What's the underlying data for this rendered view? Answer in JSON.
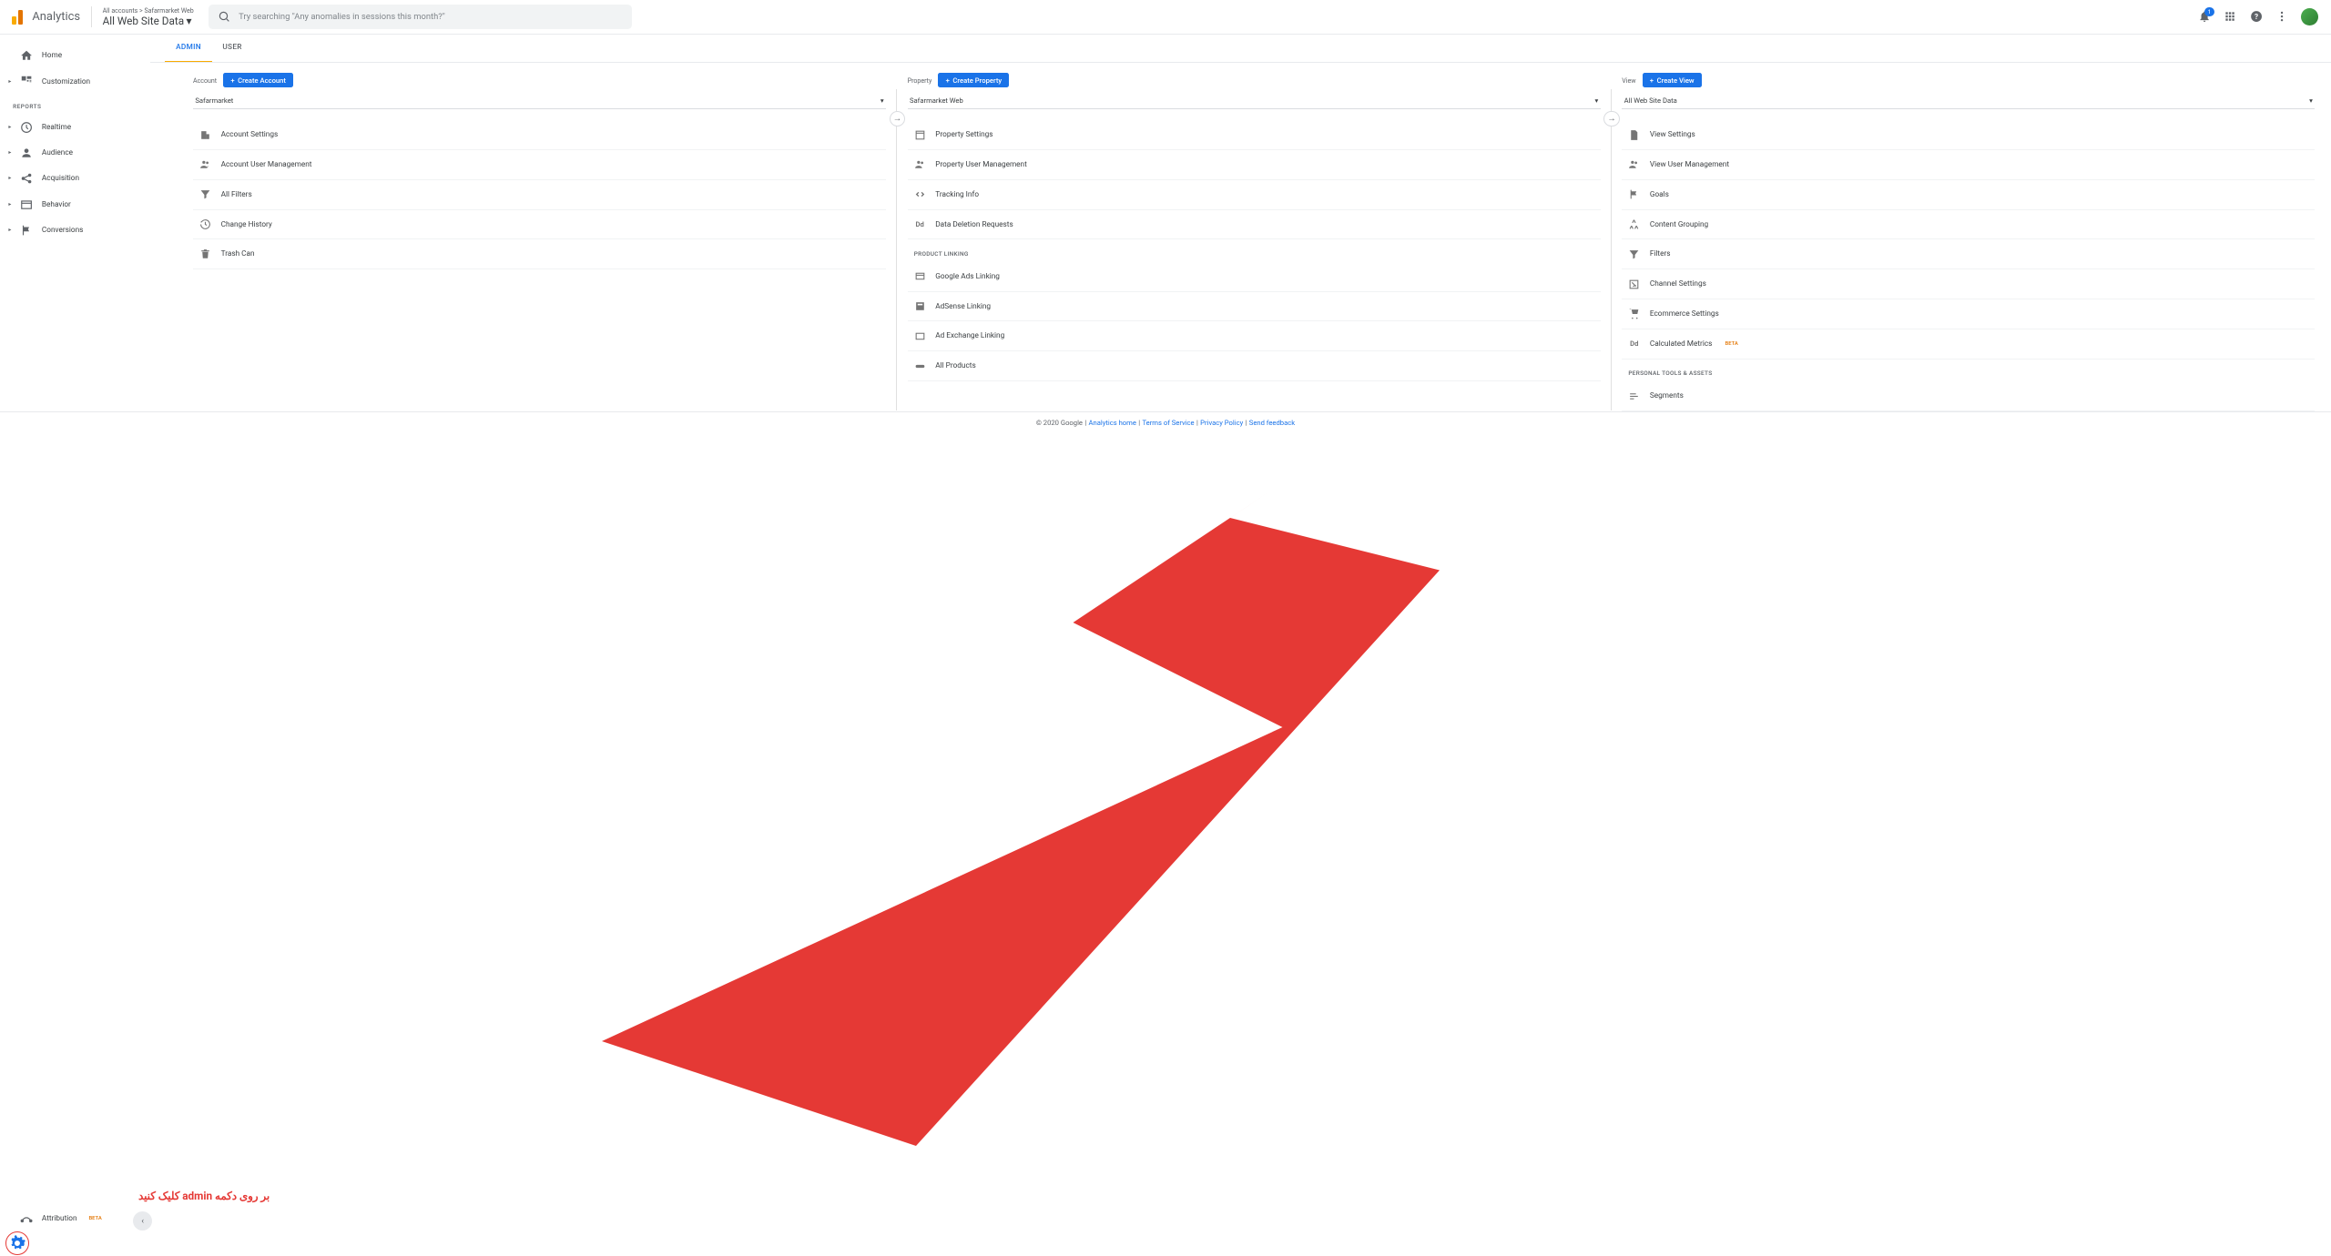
{
  "header": {
    "logo_text": "Analytics",
    "breadcrumb": "All accounts > Safarmarket Web",
    "property_name": "All Web Site Data",
    "search_placeholder": "Try searching \"Any anomalies in sessions this month?\"",
    "notif_count": "1"
  },
  "sidebar": {
    "home": "Home",
    "customization": "Customization",
    "reports_label": "REPORTS",
    "realtime": "Realtime",
    "audience": "Audience",
    "acquisition": "Acquisition",
    "behavior": "Behavior",
    "conversions": "Conversions",
    "attribution": "Attribution",
    "attribution_badge": "BETA"
  },
  "tabs": {
    "admin": "ADMIN",
    "user": "USER"
  },
  "account": {
    "label": "Account",
    "create": "Create Account",
    "selected": "Safarmarket",
    "items": [
      "Account Settings",
      "Account User Management",
      "All Filters",
      "Change History",
      "Trash Can"
    ]
  },
  "property": {
    "label": "Property",
    "create": "Create Property",
    "selected": "Safarmarket Web",
    "items": [
      "Property Settings",
      "Property User Management",
      "Tracking Info",
      "Data Deletion Requests"
    ],
    "linking_label": "PRODUCT LINKING",
    "linking": [
      "Google Ads Linking",
      "AdSense Linking",
      "Ad Exchange Linking",
      "All Products"
    ]
  },
  "view": {
    "label": "View",
    "create": "Create View",
    "selected": "All Web Site Data",
    "items": [
      "View Settings",
      "View User Management",
      "Goals",
      "Content Grouping",
      "Filters",
      "Channel Settings",
      "Ecommerce Settings"
    ],
    "calc_metrics": "Calculated Metrics",
    "calc_badge": "BETA",
    "tools_label": "PERSONAL TOOLS & ASSETS",
    "tools": [
      "Segments"
    ]
  },
  "footer": {
    "copyright": "© 2020 Google",
    "home": "Analytics home",
    "terms": "Terms of Service",
    "privacy": "Privacy Policy",
    "feedback": "Send feedback"
  },
  "annotation": "بر روی دکمه admin کلیک کنید"
}
